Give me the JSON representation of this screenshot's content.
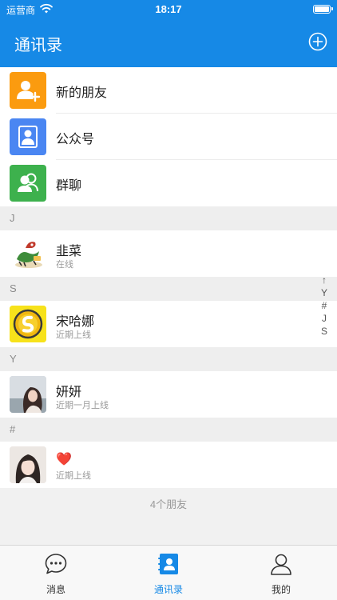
{
  "status_bar": {
    "carrier": "运营商",
    "time": "18:17"
  },
  "nav": {
    "title": "通讯录"
  },
  "features": [
    {
      "label": "新的朋友",
      "icon": "add-friend-icon",
      "color": "#fb9b0f"
    },
    {
      "label": "公众号",
      "icon": "official-account-icon",
      "color": "#4a86f2"
    },
    {
      "label": "群聊",
      "icon": "group-chat-icon",
      "color": "#3db14d"
    }
  ],
  "sections": [
    {
      "letter": "J",
      "contacts": [
        {
          "name": "韭菜",
          "status": "在线",
          "avatar": "dragon-avatar-icon"
        }
      ]
    },
    {
      "letter": "S",
      "contacts": [
        {
          "name": "宋哈娜",
          "status": "近期上线",
          "avatar": "coin-avatar-icon"
        }
      ]
    },
    {
      "letter": "Y",
      "contacts": [
        {
          "name": "妍妍",
          "status": "近期一月上线",
          "avatar": "woman-photo-avatar"
        }
      ]
    },
    {
      "letter": "#",
      "contacts": [
        {
          "name": "❤️",
          "status": "近期上线",
          "avatar": "girl-photo-avatar"
        }
      ]
    }
  ],
  "index_letters": [
    "↑",
    "Y",
    "#",
    "J",
    "S"
  ],
  "footer_count": "4个朋友",
  "tabs": [
    {
      "label": "消息",
      "icon": "chat-bubble-icon",
      "active": false
    },
    {
      "label": "通讯录",
      "icon": "contacts-book-icon",
      "active": true
    },
    {
      "label": "我的",
      "icon": "profile-icon",
      "active": false
    }
  ],
  "colors": {
    "primary": "#1689e6",
    "background": "#f1f1f1"
  }
}
